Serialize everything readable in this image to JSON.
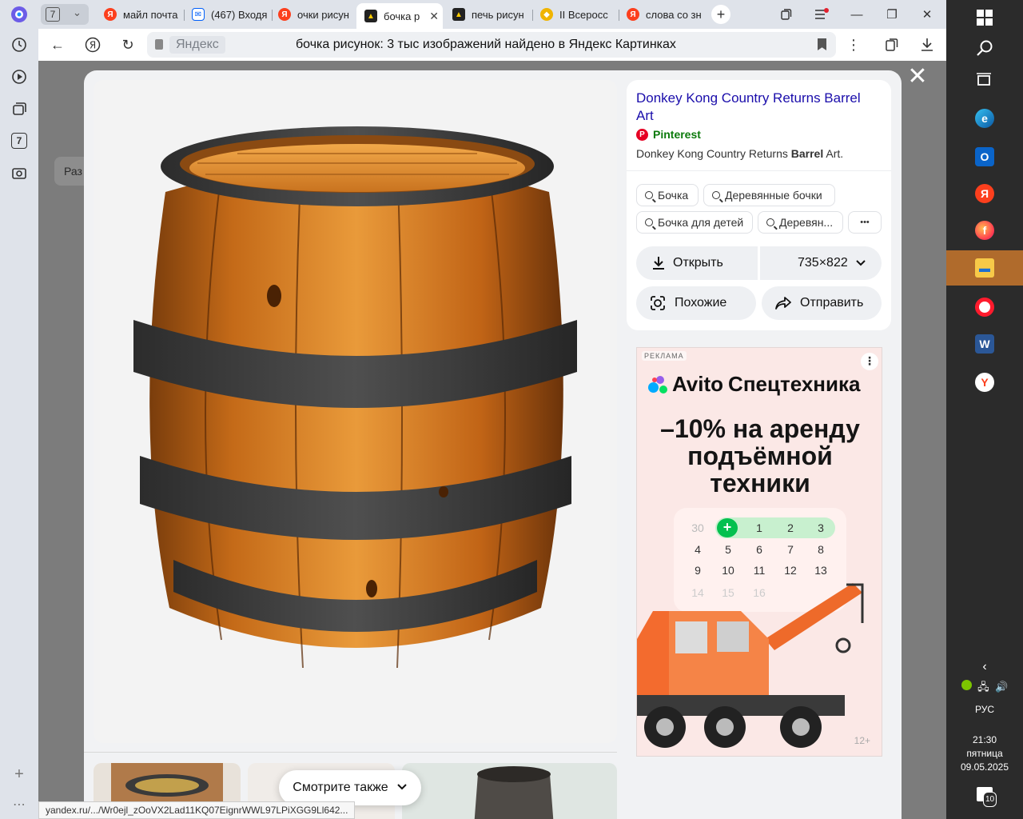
{
  "browser": {
    "tab_count": "7",
    "tabs": [
      {
        "label": "майл почта",
        "fav": "Я",
        "color": "#fc3f1d"
      },
      {
        "label": "(467) Входя",
        "fav": "✉",
        "color": "#005ff9"
      },
      {
        "label": "очки рисун",
        "fav": "Я",
        "color": "#fc3f1d"
      },
      {
        "label": "бочка р",
        "fav": "▲",
        "color": "#ffcc00"
      },
      {
        "label": "печь рисун",
        "fav": "▲",
        "color": "#ffcc00"
      },
      {
        "label": "II Всеросс",
        "fav": "◆",
        "color": "#f0b400"
      },
      {
        "label": "слова со зн",
        "fav": "Я",
        "color": "#fc3f1d"
      }
    ],
    "address_chip": "Яндекс",
    "address_query": "бочка рисунок: 3 тыс изображений найдено в Яндекс Картинках",
    "status_url": "yandex.ru/.../Wr0ejl_zOoVX2Lad11KQ07EignrWWL97LPiXGG9Ll642...",
    "page_behind_chip": "Раз"
  },
  "viewer": {
    "title": "Donkey Kong Country Returns Barrel Art",
    "source": "Pinterest",
    "description_prefix": "Donkey Kong Country Returns ",
    "description_bold": "Barrel",
    "description_suffix": " Art.",
    "tags": [
      "Бочка",
      "Деревянные бочки",
      "Бочка для детей",
      "Деревян..."
    ],
    "more_tags": "•••",
    "open_label": "Открыть",
    "size_label": "735×822",
    "similar_label": "Похожие",
    "share_label": "Отправить",
    "see_also_label": "Смотрите также"
  },
  "ad": {
    "label": "РЕКЛАМА",
    "brand": "Avito",
    "brand_suffix": "Спецтехника",
    "headline_1": "–10% на аренду",
    "headline_2": "подъёмной",
    "headline_3": "техники",
    "calendar": [
      "30",
      "+",
      "1",
      "2",
      "3",
      "4",
      "5",
      "6",
      "7",
      "8",
      "9",
      "10",
      "11",
      "12",
      "13",
      "14",
      "15",
      "16"
    ],
    "age": "12+"
  },
  "taskbar": {
    "lang": "РУС",
    "time": "21:30",
    "day": "пятница",
    "date": "09.05.2025",
    "notifications": "10"
  },
  "colors": {
    "accent_link": "#1a0dab",
    "source_green": "#0b7a0b",
    "taskbar_active": "#b06b2c"
  }
}
